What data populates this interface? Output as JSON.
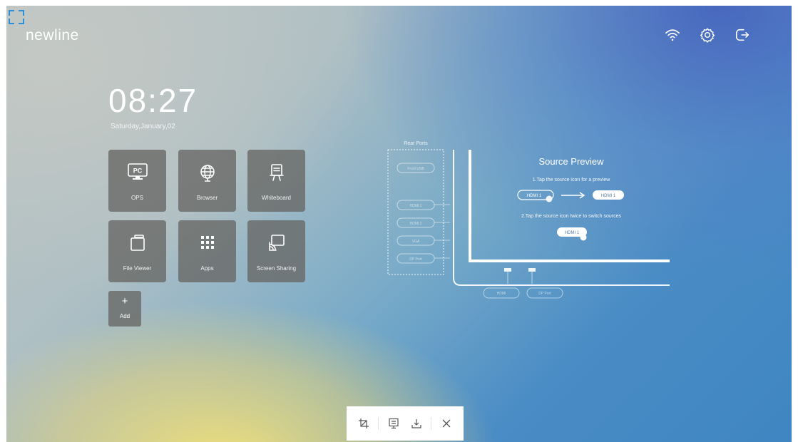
{
  "brand": {
    "logo_text": "newline",
    "accent_color": "#2e8ed6"
  },
  "status_bar": {
    "icons": [
      "wifi-icon",
      "settings-gear-icon",
      "exit-icon"
    ]
  },
  "home": {
    "time": "08:27",
    "date": "Saturday,January,02",
    "tiles": [
      {
        "label": "OPS",
        "icon": "pc-icon"
      },
      {
        "label": "Browser",
        "icon": "globe-icon"
      },
      {
        "label": "Whiteboard",
        "icon": "whiteboard-icon"
      },
      {
        "label": "File Viewer",
        "icon": "folder-icon"
      },
      {
        "label": "Apps",
        "icon": "apps-grid-icon"
      },
      {
        "label": "Screen Sharing",
        "icon": "screen-share-icon"
      }
    ],
    "add_label": "Add",
    "add_symbol": "+"
  },
  "source_preview": {
    "title": "Source Preview",
    "ports_label": "Rear Ports",
    "step1": "1.Tap the source icon for a preview",
    "step2": "2.Tap the source icon twice to switch sources",
    "source_chip": "HDMI 1",
    "port_chips": [
      "Front USB",
      "HDMI 1",
      "HDMI 2",
      "VGA",
      "DP Port"
    ],
    "front_chips": [
      "HDMI",
      "DP Port"
    ]
  },
  "toolbar": {
    "icons": [
      "crop-icon",
      "whiteboard-save-icon",
      "download-icon",
      "close-icon"
    ]
  }
}
